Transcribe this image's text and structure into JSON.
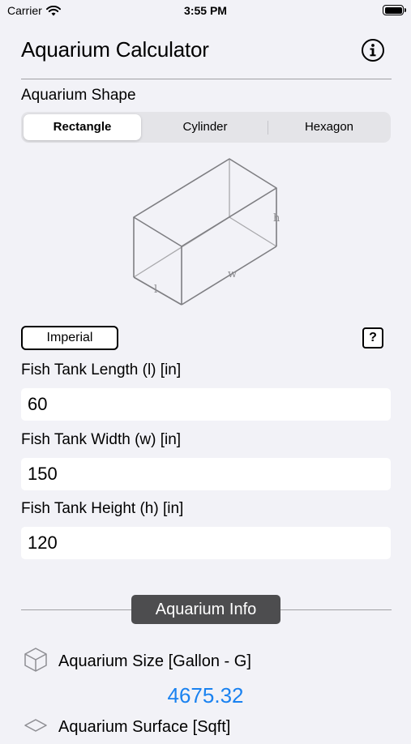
{
  "status_bar": {
    "carrier": "Carrier",
    "time": "3:55 PM"
  },
  "header": {
    "title": "Aquarium Calculator",
    "info_icon": "info-circle-icon"
  },
  "shape": {
    "label": "Aquarium Shape",
    "segments": [
      "Rectangle",
      "Cylinder",
      "Hexagon"
    ],
    "selected": "Rectangle",
    "diagram_labels": {
      "h": "h",
      "w": "w",
      "l": "l"
    }
  },
  "units": {
    "button_label": "Imperial",
    "help_label": "?"
  },
  "inputs": [
    {
      "label": "Fish Tank Length (l) [in]",
      "value": "60"
    },
    {
      "label": "Fish Tank Width (w) [in]",
      "value": "150"
    },
    {
      "label": "Fish Tank Height (h) [in]",
      "value": "120"
    }
  ],
  "results": {
    "section_title": "Aquarium Info",
    "items": [
      {
        "label": "Aquarium Size [Gallon - G]",
        "value": "4675.32",
        "icon": "cube-icon"
      },
      {
        "label": "Aquarium Surface [Sqft]",
        "icon": "surface-icon"
      }
    ]
  },
  "colors": {
    "accent": "#1a82f0",
    "pill": "#4d4d4f",
    "background": "#f2f2f7"
  }
}
